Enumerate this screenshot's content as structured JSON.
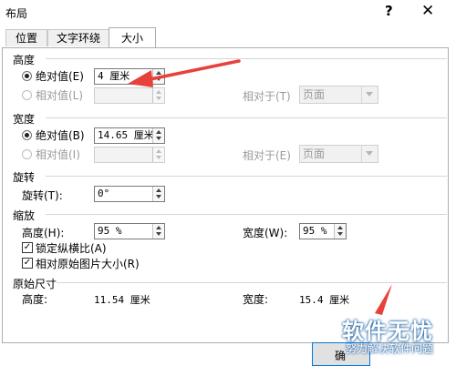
{
  "window": {
    "title": "布局",
    "help": "?",
    "close": "✕"
  },
  "tabs": [
    {
      "label": "位置"
    },
    {
      "label": "文字环绕"
    },
    {
      "label": "大小"
    }
  ],
  "height": {
    "section": "高度",
    "absolute_label": "绝对值(E)",
    "absolute_value": "4 厘米",
    "relative_label": "相对值(L)",
    "relative_to_label": "相对于(T)",
    "relative_to_value": "页面"
  },
  "width": {
    "section": "宽度",
    "absolute_label": "绝对值(B)",
    "absolute_value": "14.65 厘米",
    "relative_label": "相对值(I)",
    "relative_to_label": "相对于(E)",
    "relative_to_value": "页面"
  },
  "rotate": {
    "section": "旋转",
    "label": "旋转(T):",
    "value": "0°"
  },
  "scale": {
    "section": "缩放",
    "height_label": "高度(H):",
    "height_value": "95 %",
    "width_label": "宽度(W):",
    "width_value": "95 %",
    "lock_label": "锁定纵横比(A)",
    "relative_label": "相对原始图片大小(R)"
  },
  "original": {
    "section": "原始尺寸",
    "height_label": "高度:",
    "height_value": "11.54 厘米",
    "width_label": "宽度:",
    "width_value": "15.4 厘米"
  },
  "buttons": {
    "ok_partial": "确"
  },
  "watermark": {
    "title": "软件无忧",
    "subtitle": "努力解决软件问题"
  },
  "colors": {
    "arrow": "#e8403a",
    "focus_border": "#0078d7",
    "watermark": "#1a5ea0"
  }
}
